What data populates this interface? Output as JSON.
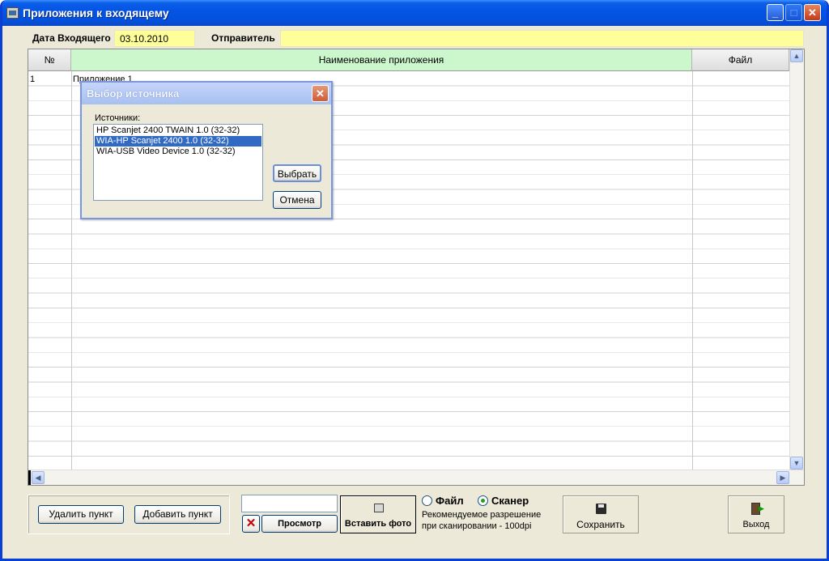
{
  "window": {
    "title": "Приложения к входящему"
  },
  "header": {
    "date_label": "Дата Входящего",
    "date_value": "03.10.2010",
    "sender_label": "Отправитель",
    "sender_value": ""
  },
  "grid": {
    "columns": [
      "№",
      "Наименование приложения",
      "Файл"
    ],
    "rows": [
      {
        "num": "1",
        "name": "Приложение 1",
        "file": ""
      }
    ]
  },
  "dialog": {
    "title": "Выбор источника",
    "sources_label": "Источники:",
    "sources": [
      "HP Scanjet 2400 TWAIN 1.0 (32-32)",
      "WIA-HP Scanjet 2400 1.0 (32-32)",
      "WIA-USB Video Device 1.0 (32-32)"
    ],
    "selected_index": 1,
    "select_button": "Выбрать",
    "cancel_button": "Отмена"
  },
  "footer": {
    "delete_button": "Удалить пункт",
    "add_button": "Добавить пункт",
    "path_value": "",
    "preview_button": "Просмотр",
    "insert_photo_button": "Вставить фото",
    "radio_file": "Файл",
    "radio_scanner": "Сканер",
    "selected_source_mode": "Сканер",
    "hint_line1": "Рекомендуемое разрешение",
    "hint_line2": "при сканировании - 100dpi",
    "save_button": "Сохранить",
    "exit_button": "Выход"
  },
  "colors": {
    "titlebar": "#0454e4",
    "field_bg": "#ffff99",
    "name_header": "#ccf7cc",
    "selection": "#316ac5"
  }
}
